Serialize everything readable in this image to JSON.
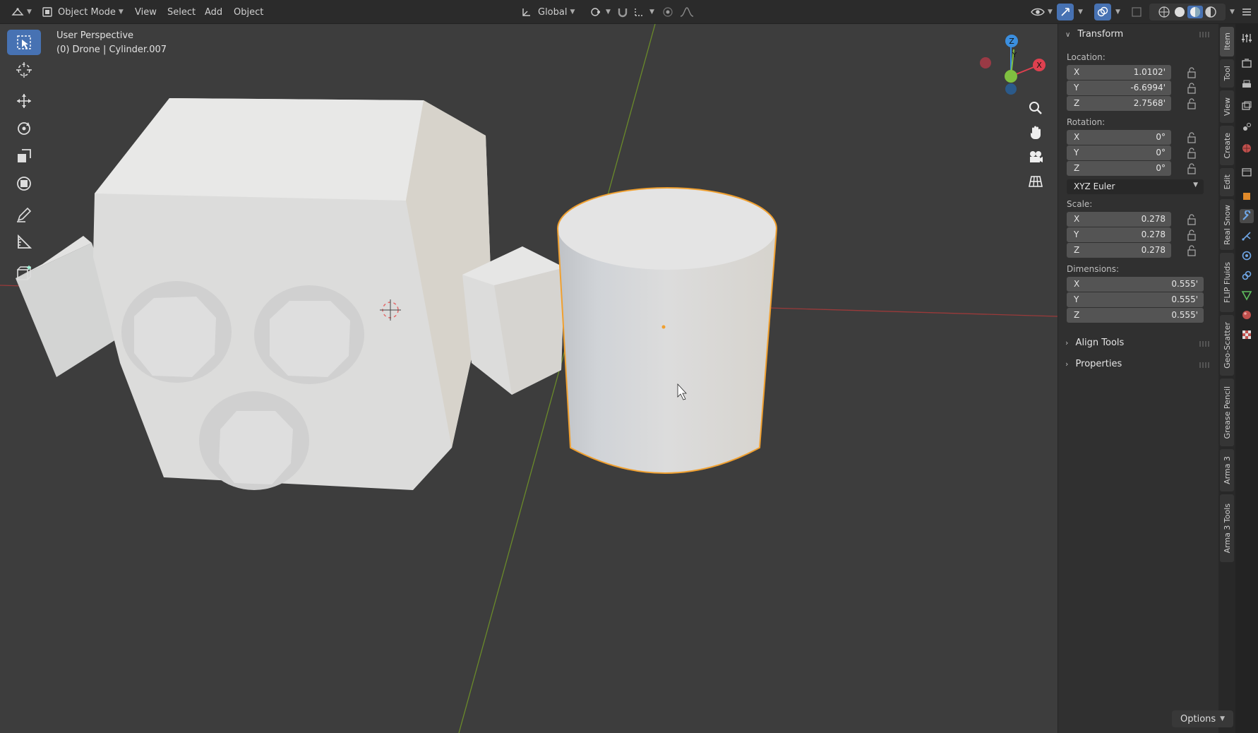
{
  "header": {
    "editor_type_icon": "3d-viewport-icon",
    "mode": "Object Mode",
    "menus": [
      "View",
      "Select",
      "Add",
      "Object"
    ],
    "transform_orientation": "Global"
  },
  "viewport": {
    "view_name": "User Perspective",
    "active_object": "(0) Drone | Cylinder.007",
    "gizmo_axes": {
      "x": "X",
      "y": "Y",
      "z": "Z"
    }
  },
  "toolbar": {
    "tools": [
      "select-box-icon",
      "cursor-icon",
      "move-icon",
      "rotate-icon",
      "scale-icon",
      "transform-icon",
      "annotate-icon",
      "measure-icon",
      "add-cube-icon"
    ],
    "active": "select-box-icon"
  },
  "npanel": {
    "transform_title": "Transform",
    "location_label": "Location:",
    "location": [
      {
        "axis": "X",
        "value": "1.0102'"
      },
      {
        "axis": "Y",
        "value": "-6.6994'"
      },
      {
        "axis": "Z",
        "value": "2.7568'"
      }
    ],
    "rotation_label": "Rotation:",
    "rotation": [
      {
        "axis": "X",
        "value": "0°"
      },
      {
        "axis": "Y",
        "value": "0°"
      },
      {
        "axis": "Z",
        "value": "0°"
      }
    ],
    "rotation_mode": "XYZ Euler",
    "scale_label": "Scale:",
    "scale": [
      {
        "axis": "X",
        "value": "0.278"
      },
      {
        "axis": "Y",
        "value": "0.278"
      },
      {
        "axis": "Z",
        "value": "0.278"
      }
    ],
    "dimensions_label": "Dimensions:",
    "dimensions": [
      {
        "axis": "X",
        "value": "0.555'"
      },
      {
        "axis": "Y",
        "value": "0.555'"
      },
      {
        "axis": "Z",
        "value": "0.555'"
      }
    ],
    "align_tools": "Align Tools",
    "properties": "Properties"
  },
  "sidetabs": [
    "Item",
    "Tool",
    "View",
    "Create",
    "Edit",
    "Real Snow",
    "FLIP Fluids",
    "Geo-Scatter",
    "Grease Pencil",
    "Arma 3",
    "Arma 3 Tools"
  ],
  "footer": {
    "options": "Options"
  },
  "colors": {
    "accent": "#4772b3",
    "selection": "#f0a030",
    "background": "#3d3d3d",
    "axis_x": "#e0404f",
    "axis_y": "#80c040",
    "axis_z": "#3b8fe0"
  }
}
